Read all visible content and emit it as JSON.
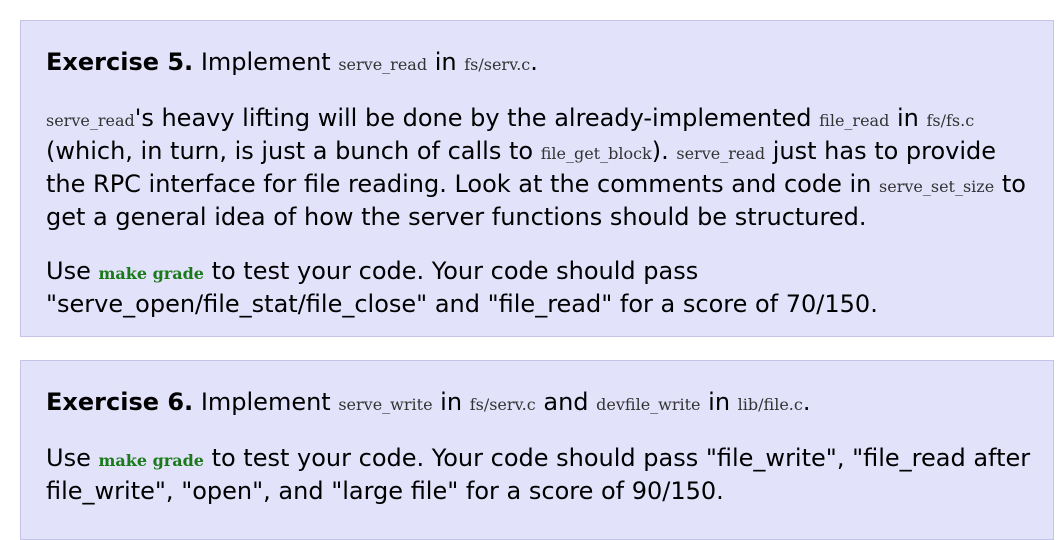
{
  "exercise5": {
    "heading": "Exercise 5.",
    "p1": {
      "t1": " Implement ",
      "code1": "serve_read",
      "t2": " in ",
      "code2": "fs/serv.c",
      "t3": "."
    },
    "p2": {
      "code1": "serve_read",
      "t1": "'s heavy lifting will be done by the already-implemented ",
      "code2": "file_read",
      "t2": " in ",
      "code3": "fs/fs.c",
      "t3": " (which, in turn, is just a bunch of calls to ",
      "code4": "file_get_block",
      "t4": "). ",
      "code5": "serve_read",
      "t5": " just has to provide the RPC interface for file reading. Look at the comments and code in ",
      "code6": "serve_set_size",
      "t6": " to get a general idea of how the server functions should be structured."
    },
    "p3": {
      "t1": "Use ",
      "cmd": "make grade",
      "t2": " to test your code. Your code should pass \"serve_open/file_stat/file_close\" and \"file_read\" for a score of 70/150."
    }
  },
  "exercise6": {
    "heading": "Exercise 6.",
    "p1": {
      "t1": " Implement ",
      "code1": "serve_write",
      "t2": " in ",
      "code2": "fs/serv.c",
      "t3": " and ",
      "code3": "devfile_write",
      "t4": " in ",
      "code4": "lib/file.c",
      "t5": "."
    },
    "p2": {
      "t1": "Use ",
      "cmd": "make grade",
      "t2": " to test your code. Your code should pass \"file_write\", \"file_read after file_write\", \"open\", and \"large file\" for a score of 90/150."
    }
  },
  "colors": {
    "box_background": "#e2e2fa",
    "box_border": "#c4c4e6",
    "command_green": "#1a7a1a",
    "text": "#000000"
  }
}
